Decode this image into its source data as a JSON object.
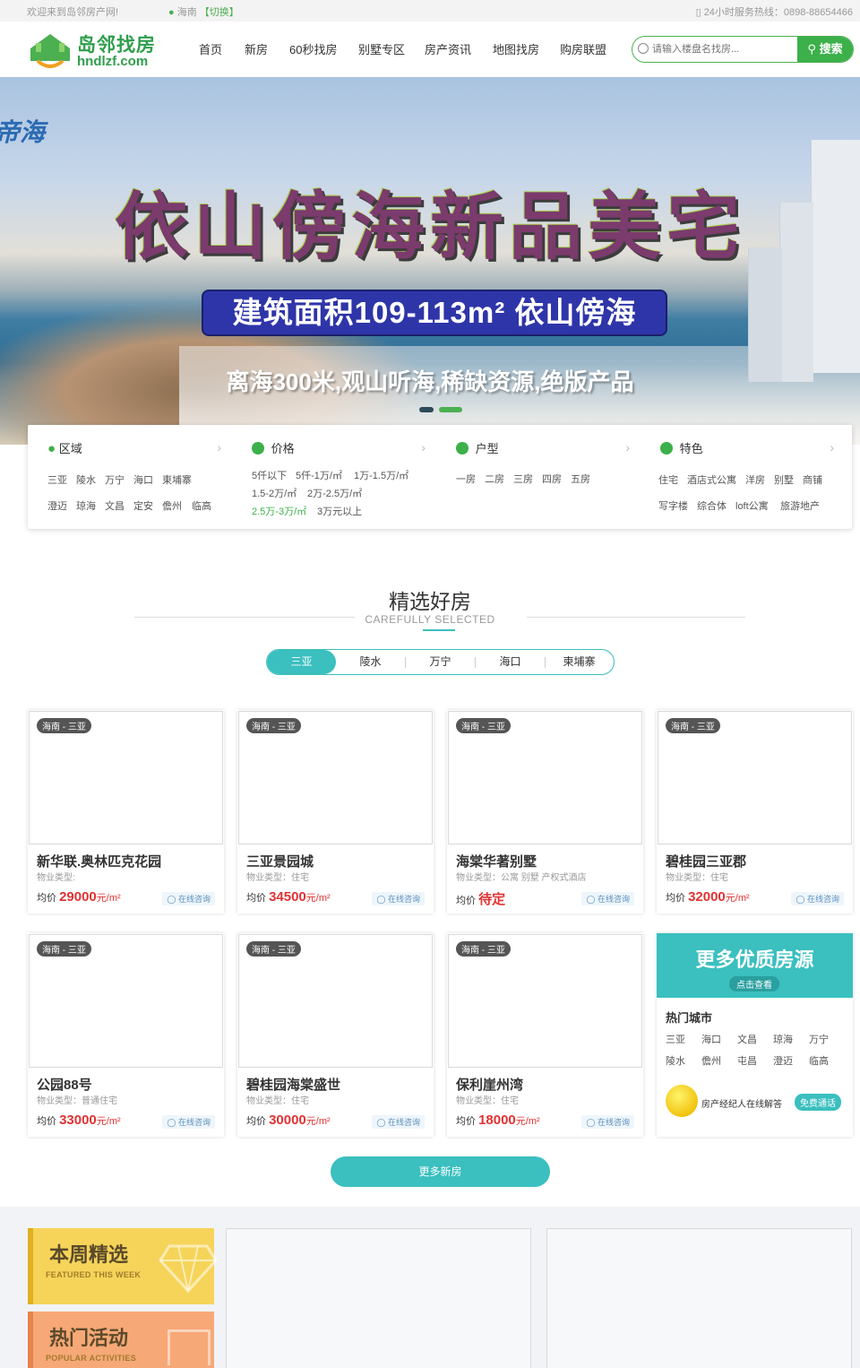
{
  "topbar": {
    "welcome": "欢迎来到岛邻房产网!",
    "location": "海南",
    "switch": "【切换】",
    "hotline": "24小时服务热线：0898-88654466"
  },
  "header": {
    "logo_cn": "岛邻找房",
    "logo_en": "hndlzf.com",
    "nav": [
      "首页",
      "新房",
      "60秒找房",
      "别墅专区",
      "房产资讯",
      "地图找房",
      "购房联盟"
    ],
    "search_placeholder": "请输入楼盘名找房...",
    "search_button": "搜索"
  },
  "banner": {
    "corner_text": "帝海",
    "headline": "依山傍海新品美宅",
    "pill": "建筑面积109-113m² 依山傍海",
    "slogan": "离海300米,观山听海,稀缺资源,绝版产品",
    "active_slide": 2
  },
  "filters": [
    {
      "title": "区域",
      "icon": "location-pin-icon",
      "rows": [
        [
          "三亚",
          "陵水",
          "万宁",
          "海口",
          "東埔寨"
        ],
        [
          "澄迈",
          "琼海",
          "文昌",
          "定安",
          "儋州",
          "临高"
        ]
      ]
    },
    {
      "title": "价格",
      "icon": "money-bag-icon",
      "rows": [
        [
          "5仟以下",
          "5仟-1万/㎡",
          "1万-1.5万/㎡"
        ],
        [
          "1.5-2万/㎡",
          "2万-2.5万/㎡"
        ],
        [
          "2.5万-3万/㎡",
          "3万元以上"
        ]
      ]
    },
    {
      "title": "户型",
      "icon": "layers-icon",
      "rows": [
        [
          "一房",
          "二房",
          "三房",
          "四房",
          "五房"
        ]
      ]
    },
    {
      "title": "特色",
      "icon": "star-badge-icon",
      "rows": [
        [
          "住宅",
          "酒店式公寓",
          "洋房",
          "别墅",
          "商铺"
        ],
        [
          "写字楼",
          "综合体",
          "loft公寓",
          "旅游地产"
        ]
      ]
    }
  ],
  "selected": {
    "title": "精选好房",
    "subtitle": "CAREFULLY SELECTED",
    "tabs": [
      "三亚",
      "陵水",
      "万宁",
      "海口",
      "柬埔寨"
    ],
    "active_tab": 0,
    "price_label": "均价",
    "ask_label": "在线咨询",
    "cards": [
      {
        "tag": "海南 - 三亚",
        "name": "新华联.奥林匹克花园",
        "type": "物业类型:",
        "price": "29000",
        "unit": "元/m²"
      },
      {
        "tag": "海南 - 三亚",
        "name": "三亚景园城",
        "type": "物业类型：住宅",
        "price": "34500",
        "unit": "元/m²"
      },
      {
        "tag": "海南 - 三亚",
        "name": "海棠华著别墅",
        "type": "物业类型：公寓 别墅 产权式酒店",
        "price": "待定",
        "unit": ""
      },
      {
        "tag": "海南 - 三亚",
        "name": "碧桂园三亚郡",
        "type": "物业类型：住宅",
        "price": "32000",
        "unit": "元/m²"
      },
      {
        "tag": "海南 - 三亚",
        "name": "公园88号",
        "type": "物业类型：普通住宅",
        "price": "33000",
        "unit": "元/m²"
      },
      {
        "tag": "海南 - 三亚",
        "name": "碧桂园海棠盛世",
        "type": "物业类型：住宅",
        "price": "30000",
        "unit": "元/m²"
      },
      {
        "tag": "海南 - 三亚",
        "name": "保利崖州湾",
        "type": "物业类型：住宅",
        "price": "18000",
        "unit": "元/m²"
      }
    ],
    "more_card": {
      "headline": "更多优质房源",
      "button": "点击查看",
      "hot_cities_title": "热门城市",
      "cities": [
        [
          "三亚",
          "海口",
          "文昌",
          "琼海",
          "万宁"
        ],
        [
          "陵水",
          "儋州",
          "屯昌",
          "澄迈",
          "临高"
        ]
      ],
      "agent_text": "房产经纪人在线解答",
      "free_call": "免费通话"
    },
    "more_button": "更多新房"
  },
  "bottom": {
    "promo1": {
      "title": "本周精选",
      "subtitle": "FEATURED THIS WEEK"
    },
    "promo2": {
      "title": "热门活动",
      "subtitle": "POPULAR ACTIVITIES"
    }
  },
  "colors": {
    "brand_green": "#3cb04a",
    "accent_teal": "#3bbfbf",
    "price_red": "#e23232"
  }
}
